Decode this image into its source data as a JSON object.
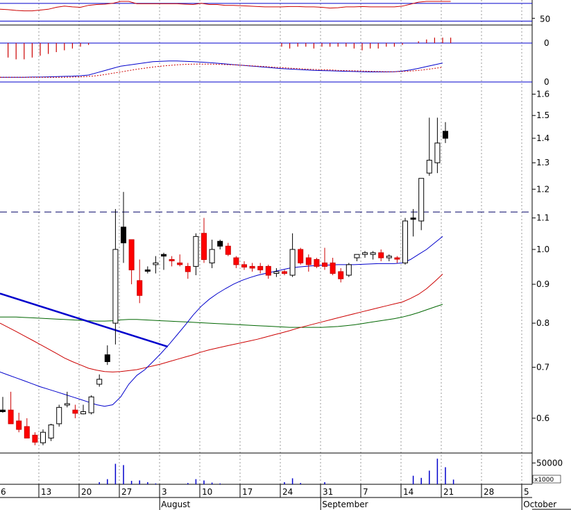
{
  "chart_data": {
    "type": "candlestick",
    "title": "",
    "series_colors": {
      "up": "#ffffff",
      "down_red": "#ff0000",
      "down_black": "#000000",
      "ma_blue": "#0000cc",
      "ma_red": "#cc0000",
      "ma_green": "#006600",
      "trendline": "#0000cc",
      "volume": "#0000cc"
    },
    "x_ticks": [
      {
        "i": 0,
        "label": "6"
      },
      {
        "i": 5,
        "label": "13"
      },
      {
        "i": 10,
        "label": "20"
      },
      {
        "i": 15,
        "label": "27"
      },
      {
        "i": 20,
        "label": "3"
      },
      {
        "i": 25,
        "label": "10"
      },
      {
        "i": 30,
        "label": "17"
      },
      {
        "i": 35,
        "label": "24"
      },
      {
        "i": 40,
        "label": "31"
      },
      {
        "i": 45,
        "label": "7"
      },
      {
        "i": 50,
        "label": "14"
      },
      {
        "i": 55,
        "label": "21"
      },
      {
        "i": 60,
        "label": "28"
      },
      {
        "i": 65,
        "label": "5"
      }
    ],
    "months": [
      {
        "i": 19.5,
        "label": "August"
      },
      {
        "i": 39.5,
        "label": "September"
      },
      {
        "i": 64.5,
        "label": "October"
      }
    ],
    "price_axis": {
      "scale": "log",
      "ylim": [
        0.54,
        1.66
      ],
      "ticks": [
        0.6,
        0.7,
        0.8,
        0.9,
        1.0,
        1.1,
        1.2,
        1.3,
        1.4,
        1.5,
        1.6
      ],
      "tick_labels": [
        "0.6",
        "0.7",
        "0.8",
        "0.9",
        "1.0",
        "1.1",
        "1.2",
        "1.3",
        "1.4",
        "1.5",
        "1.6"
      ]
    },
    "reference_line": 1.12,
    "candles": [
      {
        "o": 0.615,
        "h": 0.64,
        "l": 0.61,
        "c": 0.612,
        "col": "b"
      },
      {
        "o": 0.615,
        "h": 0.65,
        "l": 0.59,
        "c": 0.59,
        "col": "r"
      },
      {
        "o": 0.595,
        "h": 0.61,
        "l": 0.575,
        "c": 0.58,
        "col": "r"
      },
      {
        "o": 0.585,
        "h": 0.6,
        "l": 0.565,
        "c": 0.565,
        "col": "r"
      },
      {
        "o": 0.57,
        "h": 0.575,
        "l": 0.553,
        "c": 0.558,
        "col": "r"
      },
      {
        "o": 0.557,
        "h": 0.58,
        "l": 0.553,
        "c": 0.575,
        "col": "w"
      },
      {
        "o": 0.565,
        "h": 0.59,
        "l": 0.56,
        "c": 0.588,
        "col": "w"
      },
      {
        "o": 0.59,
        "h": 0.625,
        "l": 0.585,
        "c": 0.62,
        "col": "w"
      },
      {
        "o": 0.625,
        "h": 0.65,
        "l": 0.62,
        "c": 0.627,
        "col": "w"
      },
      {
        "o": 0.615,
        "h": 0.625,
        "l": 0.6,
        "c": 0.609,
        "col": "r"
      },
      {
        "o": 0.608,
        "h": 0.625,
        "l": 0.607,
        "c": 0.612,
        "col": "w"
      },
      {
        "o": 0.61,
        "h": 0.643,
        "l": 0.607,
        "c": 0.64,
        "col": "w"
      },
      {
        "o": 0.665,
        "h": 0.685,
        "l": 0.66,
        "c": 0.675,
        "col": "w"
      },
      {
        "o": 0.727,
        "h": 0.748,
        "l": 0.705,
        "c": 0.712,
        "col": "b"
      },
      {
        "o": 0.8,
        "h": 1.13,
        "l": 0.75,
        "c": 1.0,
        "col": "w"
      },
      {
        "o": 1.07,
        "h": 1.19,
        "l": 0.96,
        "c": 1.02,
        "col": "b"
      },
      {
        "o": 1.03,
        "h": 1.03,
        "l": 0.9,
        "c": 0.94,
        "col": "r"
      },
      {
        "o": 0.91,
        "h": 0.97,
        "l": 0.85,
        "c": 0.87,
        "col": "r"
      },
      {
        "o": 0.94,
        "h": 0.95,
        "l": 0.93,
        "c": 0.94,
        "col": "b"
      },
      {
        "o": 0.955,
        "h": 0.98,
        "l": 0.93,
        "c": 0.96,
        "col": "w"
      },
      {
        "o": 0.985,
        "h": 0.99,
        "l": 0.94,
        "c": 0.98,
        "col": "b"
      },
      {
        "o": 0.97,
        "h": 0.98,
        "l": 0.95,
        "c": 0.97,
        "col": "r"
      },
      {
        "o": 0.96,
        "h": 0.985,
        "l": 0.95,
        "c": 0.955,
        "col": "r"
      },
      {
        "o": 0.95,
        "h": 0.96,
        "l": 0.915,
        "c": 0.935,
        "col": "r"
      },
      {
        "o": 0.95,
        "h": 1.05,
        "l": 0.925,
        "c": 1.04,
        "col": "w"
      },
      {
        "o": 1.05,
        "h": 1.1,
        "l": 0.96,
        "c": 0.97,
        "col": "r"
      },
      {
        "o": 0.96,
        "h": 1.03,
        "l": 0.945,
        "c": 1.0,
        "col": "w"
      },
      {
        "o": 1.025,
        "h": 1.03,
        "l": 1.0,
        "c": 1.01,
        "col": "b"
      },
      {
        "o": 1.01,
        "h": 1.02,
        "l": 0.98,
        "c": 0.985,
        "col": "r"
      },
      {
        "o": 0.975,
        "h": 0.98,
        "l": 0.945,
        "c": 0.955,
        "col": "r"
      },
      {
        "o": 0.955,
        "h": 0.965,
        "l": 0.94,
        "c": 0.948,
        "col": "r"
      },
      {
        "o": 0.95,
        "h": 0.96,
        "l": 0.935,
        "c": 0.945,
        "col": "r"
      },
      {
        "o": 0.95,
        "h": 0.96,
        "l": 0.93,
        "c": 0.94,
        "col": "r"
      },
      {
        "o": 0.95,
        "h": 0.955,
        "l": 0.915,
        "c": 0.925,
        "col": "r"
      },
      {
        "o": 0.935,
        "h": 0.945,
        "l": 0.92,
        "c": 0.93,
        "col": "w"
      },
      {
        "o": 0.93,
        "h": 0.94,
        "l": 0.925,
        "c": 0.935,
        "col": "r"
      },
      {
        "o": 0.925,
        "h": 1.05,
        "l": 0.92,
        "c": 1.0,
        "col": "w"
      },
      {
        "o": 1.0,
        "h": 1.005,
        "l": 0.955,
        "c": 0.96,
        "col": "r"
      },
      {
        "o": 0.975,
        "h": 0.985,
        "l": 0.935,
        "c": 0.955,
        "col": "r"
      },
      {
        "o": 0.97,
        "h": 0.975,
        "l": 0.945,
        "c": 0.95,
        "col": "r"
      },
      {
        "o": 0.95,
        "h": 1.005,
        "l": 0.94,
        "c": 0.96,
        "col": "r"
      },
      {
        "o": 0.96,
        "h": 0.975,
        "l": 0.925,
        "c": 0.93,
        "col": "r"
      },
      {
        "o": 0.935,
        "h": 0.945,
        "l": 0.905,
        "c": 0.915,
        "col": "r"
      },
      {
        "o": 0.925,
        "h": 0.96,
        "l": 0.92,
        "c": 0.955,
        "col": "w"
      },
      {
        "o": 0.975,
        "h": 0.98,
        "l": 0.965,
        "c": 0.985,
        "col": "w"
      },
      {
        "o": 0.985,
        "h": 0.995,
        "l": 0.975,
        "c": 0.99,
        "col": "w"
      },
      {
        "o": 0.985,
        "h": 0.995,
        "l": 0.97,
        "c": 0.99,
        "col": "w"
      },
      {
        "o": 0.99,
        "h": 1.0,
        "l": 0.965,
        "c": 0.975,
        "col": "r"
      },
      {
        "o": 0.975,
        "h": 0.985,
        "l": 0.965,
        "c": 0.98,
        "col": "w"
      },
      {
        "o": 0.975,
        "h": 0.98,
        "l": 0.96,
        "c": 0.975,
        "col": "r"
      },
      {
        "o": 0.96,
        "h": 1.1,
        "l": 0.955,
        "c": 1.09,
        "col": "w"
      },
      {
        "o": 1.1,
        "h": 1.13,
        "l": 1.04,
        "c": 1.1,
        "col": "b"
      },
      {
        "o": 1.09,
        "h": 1.12,
        "l": 1.06,
        "c": 1.24,
        "col": "w"
      },
      {
        "o": 1.26,
        "h": 1.49,
        "l": 1.25,
        "c": 1.31,
        "col": "w"
      },
      {
        "o": 1.3,
        "h": 1.49,
        "l": 1.26,
        "c": 1.38,
        "col": "w"
      },
      {
        "o": 1.43,
        "h": 1.47,
        "l": 1.38,
        "c": 1.4,
        "col": "b"
      }
    ],
    "ma_fast": [
      0.69,
      0.684,
      0.678,
      0.672,
      0.666,
      0.66,
      0.655,
      0.65,
      0.645,
      0.64,
      0.635,
      0.63,
      0.625,
      0.622,
      0.625,
      0.64,
      0.665,
      0.683,
      0.695,
      0.712,
      0.73,
      0.75,
      0.772,
      0.795,
      0.82,
      0.842,
      0.86,
      0.875,
      0.888,
      0.9,
      0.91,
      0.918,
      0.925,
      0.93,
      0.935,
      0.94,
      0.945,
      0.948,
      0.95,
      0.952,
      0.953,
      0.954,
      0.955,
      0.955,
      0.955,
      0.956,
      0.957,
      0.958,
      0.958,
      0.958,
      0.96,
      0.97,
      0.985,
      1.0,
      1.02,
      1.04
    ],
    "ma_mid": [
      0.8,
      0.79,
      0.78,
      0.77,
      0.76,
      0.75,
      0.74,
      0.73,
      0.72,
      0.712,
      0.705,
      0.698,
      0.694,
      0.691,
      0.69,
      0.691,
      0.693,
      0.695,
      0.699,
      0.703,
      0.707,
      0.712,
      0.717,
      0.722,
      0.727,
      0.733,
      0.738,
      0.742,
      0.746,
      0.75,
      0.754,
      0.758,
      0.762,
      0.767,
      0.772,
      0.777,
      0.782,
      0.788,
      0.793,
      0.798,
      0.803,
      0.808,
      0.813,
      0.818,
      0.823,
      0.828,
      0.833,
      0.838,
      0.843,
      0.848,
      0.853,
      0.862,
      0.873,
      0.888,
      0.907,
      0.928
    ],
    "ma_slow": [
      0.815,
      0.815,
      0.815,
      0.814,
      0.813,
      0.812,
      0.811,
      0.81,
      0.809,
      0.808,
      0.807,
      0.806,
      0.805,
      0.805,
      0.806,
      0.808,
      0.809,
      0.809,
      0.808,
      0.807,
      0.806,
      0.805,
      0.804,
      0.803,
      0.802,
      0.801,
      0.8,
      0.799,
      0.798,
      0.797,
      0.796,
      0.795,
      0.794,
      0.793,
      0.792,
      0.791,
      0.79,
      0.79,
      0.79,
      0.79,
      0.79,
      0.791,
      0.792,
      0.794,
      0.796,
      0.799,
      0.802,
      0.805,
      0.808,
      0.811,
      0.815,
      0.82,
      0.826,
      0.833,
      0.84,
      0.847
    ],
    "trendline": {
      "x0": -1,
      "y0": 0.875,
      "x1": 20.5,
      "y1": 0.745
    },
    "volume": [
      0,
      0,
      0,
      0,
      0,
      0,
      0,
      0,
      0,
      0,
      0,
      0,
      5000,
      12000,
      48000,
      45000,
      8000,
      9000,
      5000,
      2000,
      0,
      0,
      0,
      3000,
      12000,
      9000,
      4000,
      2000,
      0,
      0,
      0,
      0,
      0,
      0,
      0,
      5000,
      14000,
      3000,
      0,
      0,
      5000,
      0,
      0,
      0,
      0,
      0,
      0,
      0,
      0,
      0,
      0,
      20000,
      15000,
      32000,
      60000,
      40000,
      11000
    ],
    "volume_axis": {
      "tick": 50000,
      "tick_label": "50000",
      "unit_label": "x1000"
    },
    "top_panel": {
      "values": [
        80,
        79,
        77,
        76,
        76,
        78,
        80,
        85,
        88,
        86,
        85,
        90,
        92,
        93,
        95,
        100,
        100,
        94,
        94,
        94,
        94,
        94,
        94,
        93,
        92,
        95,
        92,
        92,
        90,
        90,
        89,
        88,
        87,
        86,
        86,
        86,
        87,
        87,
        86,
        86,
        85,
        83,
        84,
        86,
        86,
        87,
        86,
        86,
        86,
        86,
        88,
        93,
        98,
        100,
        100,
        100,
        100
      ],
      "ref_lines": [
        95,
        50
      ],
      "tick_label": "50"
    },
    "hist_panel": {
      "values": [
        -0.0,
        -0.8,
        -0.9,
        -0.9,
        -0.8,
        -0.7,
        -0.6,
        -0.5,
        -0.4,
        -0.3,
        -0.2,
        -0.1,
        0,
        0,
        0,
        0,
        0,
        0,
        0,
        0,
        0,
        0,
        0,
        0,
        0,
        0,
        0,
        0,
        0,
        0,
        0,
        0,
        0,
        0,
        0,
        -0.2,
        -0.3,
        -0.2,
        -0.2,
        -0.3,
        -0.2,
        -0.2,
        -0.2,
        -0.2,
        -0.3,
        -0.4,
        -0.3,
        -0.3,
        -0.2,
        -0.2,
        -0.1,
        0,
        0.1,
        0.2,
        0.3,
        0.3,
        0.3
      ],
      "tick_label": "0"
    },
    "macd_panel": {
      "line": [
        -1,
        -1,
        -1,
        -1,
        -0.9,
        -0.9,
        -0.8,
        -0.7,
        -0.6,
        -0.5,
        -0.3,
        0,
        1,
        2,
        3,
        4,
        4.5,
        5,
        5.5,
        6,
        6.2,
        6.3,
        6.3,
        6.2,
        6.0,
        5.8,
        5.6,
        5.3,
        5.0,
        4.7,
        4.4,
        4.1,
        3.8,
        3.5,
        3.2,
        2.9,
        2.7,
        2.5,
        2.3,
        2.1,
        2.0,
        1.9,
        1.8,
        1.7,
        1.6,
        1.5,
        1.4,
        1.4,
        1.4,
        1.5,
        1.8,
        2.3,
        3.0,
        3.8,
        4.6,
        5.4
      ],
      "signal": [
        -1,
        -1,
        -1,
        -1,
        -1,
        -1,
        -1,
        -1,
        -1,
        -0.9,
        -0.8,
        -0.6,
        -0.3,
        0.2,
        0.8,
        1.4,
        2.0,
        2.6,
        3.1,
        3.6,
        4.0,
        4.3,
        4.6,
        4.8,
        4.9,
        4.9,
        4.9,
        4.8,
        4.7,
        4.6,
        4.4,
        4.2,
        4.0,
        3.8,
        3.5,
        3.3,
        3.1,
        2.9,
        2.7,
        2.5,
        2.4,
        2.3,
        2.1,
        2.0,
        1.9,
        1.8,
        1.7,
        1.6,
        1.5,
        1.5,
        1.6,
        1.8,
        2.1,
        2.5,
        3.0,
        3.5
      ],
      "tick_label": "0"
    }
  }
}
